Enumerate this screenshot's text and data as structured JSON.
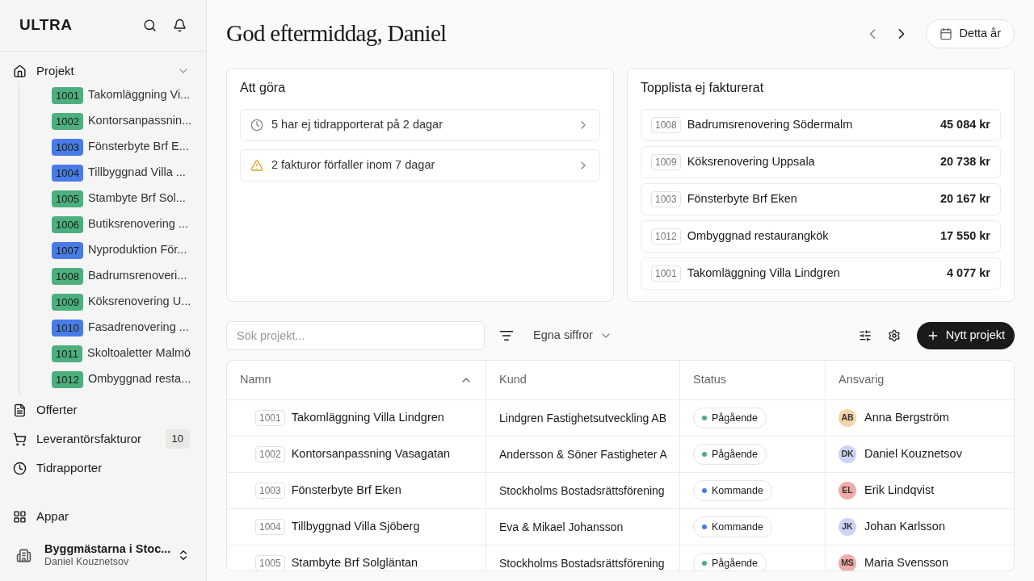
{
  "sidebar": {
    "logo": "ULTRA",
    "nav_top": {
      "label": "Projekt",
      "expanded": true
    },
    "projects": [
      {
        "number": "1001",
        "name": "Takomläggning Vi...",
        "color": "#4caf7d"
      },
      {
        "number": "1002",
        "name": "Kontorsanpassnin...",
        "color": "#4caf7d"
      },
      {
        "number": "1003",
        "name": "Fönsterbyte Brf E...",
        "color": "#4a7ae8"
      },
      {
        "number": "1004",
        "name": "Tillbyggnad Villa ...",
        "color": "#4a7ae8"
      },
      {
        "number": "1005",
        "name": "Stambyte Brf Sol...",
        "color": "#4caf7d"
      },
      {
        "number": "1006",
        "name": "Butiksrenovering ...",
        "color": "#4caf7d"
      },
      {
        "number": "1007",
        "name": "Nyproduktion För...",
        "color": "#4a7ae8"
      },
      {
        "number": "1008",
        "name": "Badrumsrenoveri...",
        "color": "#4caf7d"
      },
      {
        "number": "1009",
        "name": "Köksrenovering U...",
        "color": "#4caf7d"
      },
      {
        "number": "1010",
        "name": "Fasadrenovering ...",
        "color": "#4a7ae8"
      },
      {
        "number": "1011",
        "name": "Skoltoaletter Malmö",
        "color": "#4caf7d"
      },
      {
        "number": "1012",
        "name": "Ombyggnad resta...",
        "color": "#4caf7d"
      }
    ],
    "nav": [
      {
        "kind": "document",
        "label": "Offerter"
      },
      {
        "kind": "cart",
        "label": "Leverantörsfakturor",
        "count": "10"
      },
      {
        "kind": "clock",
        "label": "Tidrapporter"
      }
    ],
    "apps": "Appar",
    "org": {
      "name": "Byggmästarna i Stoc...",
      "user": "Daniel Kouznetsov"
    }
  },
  "header": {
    "greeting": "God eftermiddag, Daniel",
    "period": "Detta år"
  },
  "todo": {
    "title": "Att göra",
    "items": [
      {
        "kind": "clock",
        "text": "5 har ej tidrapporterat på 2 dagar"
      },
      {
        "kind": "warning",
        "text": "2 fakturor förfaller inom 7 dagar"
      }
    ]
  },
  "toplist": {
    "title": "Topplista ej fakturerat",
    "items": [
      {
        "number": "1008",
        "name": "Badrumsrenovering Södermalm",
        "amount": "45 084 kr"
      },
      {
        "number": "1009",
        "name": "Köksrenovering Uppsala",
        "amount": "20 738 kr"
      },
      {
        "number": "1003",
        "name": "Fönsterbyte Brf Eken",
        "amount": "20 167 kr"
      },
      {
        "number": "1012",
        "name": "Ombyggnad restaurangkök",
        "amount": "17 550 kr"
      },
      {
        "number": "1001",
        "name": "Takomläggning Villa Lindgren",
        "amount": "4 077 kr"
      }
    ]
  },
  "toolbar": {
    "search_placeholder": "Sök projekt...",
    "view": "Egna siffror",
    "new_button": "Nytt projekt"
  },
  "table": {
    "columns": [
      "Namn",
      "Kund",
      "Status",
      "Ansvarig"
    ],
    "rows": [
      {
        "number": "1001",
        "name": "Takomläggning Villa Lindgren",
        "customer": "Lindgren Fastighetsutveckling AB",
        "status": {
          "label": "Pågående",
          "color": "#4caf7d"
        },
        "assignee": {
          "initials": "AB",
          "color": "#f7d4a8",
          "name": "Anna Bergström"
        }
      },
      {
        "number": "1002",
        "name": "Kontorsanpassning Vasagatan",
        "customer": "Andersson & Söner Fastigheter A",
        "status": {
          "label": "Pågående",
          "color": "#4caf7d"
        },
        "assignee": {
          "initials": "DK",
          "color": "#cdd3f7",
          "name": "Daniel Kouznetsov"
        }
      },
      {
        "number": "1003",
        "name": "Fönsterbyte Brf Eken",
        "customer": "Stockholms Bostadsrättsförening",
        "status": {
          "label": "Kommande",
          "color": "#4a7ae8"
        },
        "assignee": {
          "initials": "EL",
          "color": "#f2aaa8",
          "name": "Erik Lindqvist"
        }
      },
      {
        "number": "1004",
        "name": "Tillbyggnad Villa Sjöberg",
        "customer": "Eva & Mikael Johansson",
        "status": {
          "label": "Kommande",
          "color": "#4a7ae8"
        },
        "assignee": {
          "initials": "JK",
          "color": "#cdd3f7",
          "name": "Johan Karlsson"
        }
      },
      {
        "number": "1005",
        "name": "Stambyte Brf Solgläntan",
        "customer": "Stockholms Bostadsrättsförening",
        "status": {
          "label": "Pågående",
          "color": "#4caf7d"
        },
        "assignee": {
          "initials": "MS",
          "color": "#f2aaa8",
          "name": "Maria Svensson"
        }
      }
    ]
  }
}
